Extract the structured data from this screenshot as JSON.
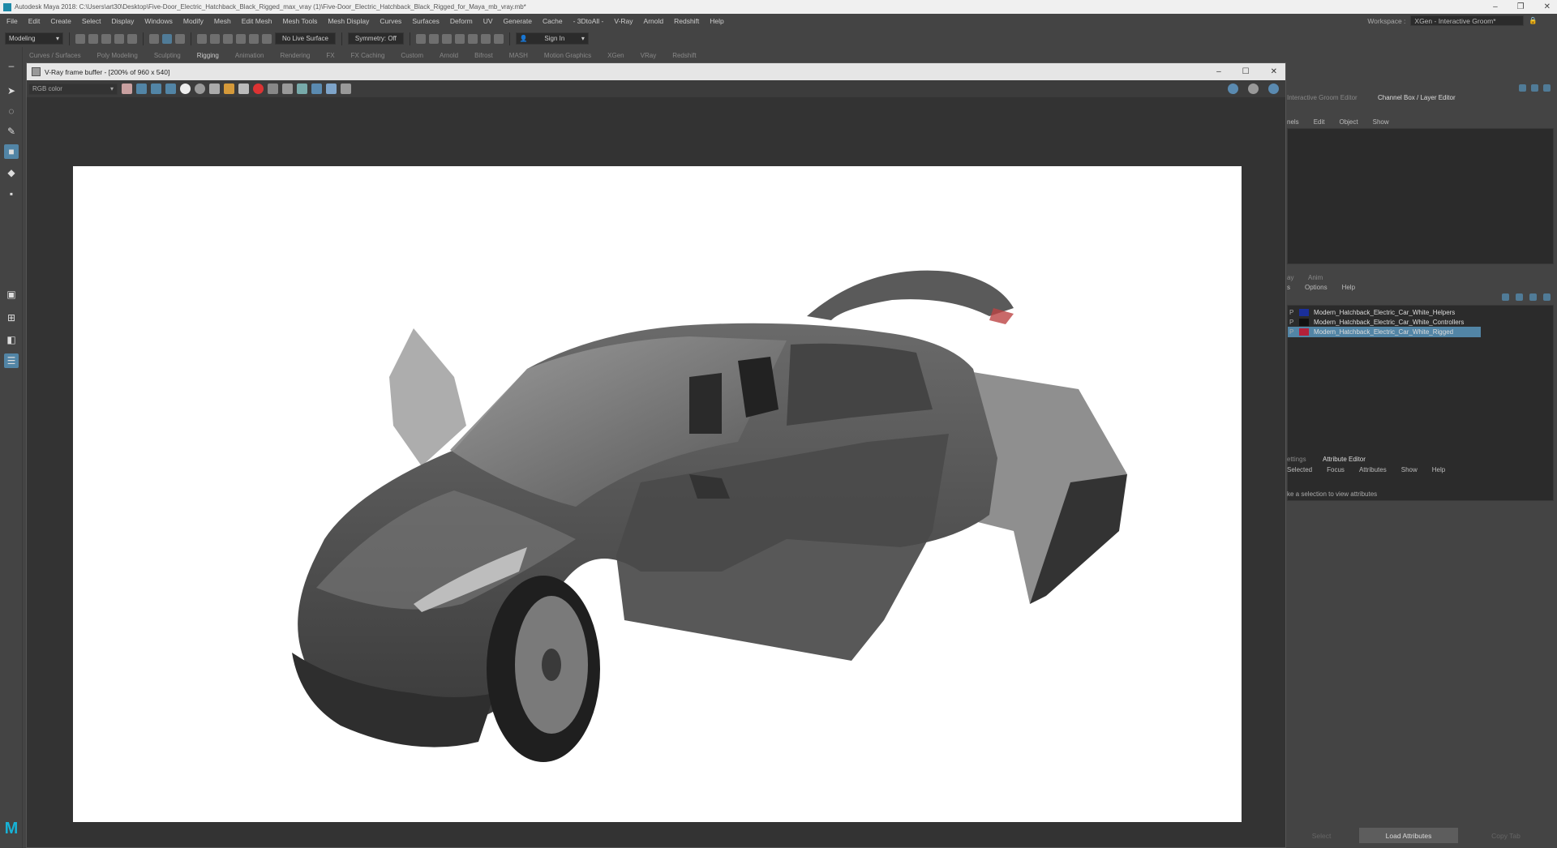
{
  "window": {
    "title": "Autodesk Maya 2018: C:\\Users\\art30\\Desktop\\Five-Door_Electric_Hatchback_Black_Rigged_max_vray (1)\\Five-Door_Electric_Hatchback_Black_Rigged_for_Maya_mb_vray.mb*"
  },
  "menus": [
    "File",
    "Edit",
    "Create",
    "Select",
    "Display",
    "Windows",
    "Modify",
    "Mesh",
    "Edit Mesh",
    "Mesh Tools",
    "Mesh Display",
    "Curves",
    "Surfaces",
    "Deform",
    "UV",
    "Generate",
    "Cache",
    "- 3DtoAll -",
    "V-Ray",
    "Arnold",
    "Redshift",
    "Help"
  ],
  "workspace": {
    "label": "Workspace :",
    "value": "XGen - Interactive Groom*"
  },
  "status": {
    "mode": "Modeling",
    "live_surface": "No Live Surface",
    "symmetry": "Symmetry: Off",
    "sign_in": "Sign In"
  },
  "shelf_tabs": [
    "Curves / Surfaces",
    "Poly Modeling",
    "Sculpting",
    "Rigging",
    "Animation",
    "Rendering",
    "FX",
    "FX Caching",
    "Custom",
    "Arnold",
    "Bifrost",
    "MASH",
    "Motion Graphics",
    "XGen",
    "VRay",
    "Redshift"
  ],
  "shelf_active": "Rigging",
  "vray": {
    "title": "V-Ray frame buffer - [200% of 960 x 540]",
    "channel": "RGB color"
  },
  "right_panel": {
    "tab_left": "Interactive Groom Editor",
    "tab_right": "Channel Box / Layer Editor",
    "cb_menu": [
      "nels",
      "Edit",
      "Object",
      "Show"
    ],
    "layer_tabs": [
      "ay",
      "Anim"
    ],
    "layer_menu": [
      "s",
      "Options",
      "Help"
    ],
    "layers": [
      {
        "v": "P",
        "color": "#1a2f9a",
        "name": "Modern_Hatchback_Electric_Car_White_Helpers",
        "selected": false
      },
      {
        "v": "P",
        "color": "#111111",
        "name": "Modern_Hatchback_Electric_Car_White_Controllers",
        "selected": false
      },
      {
        "v": "P",
        "color": "#b3213a",
        "name": "Modern_Hatchback_Electric_Car_White_Rigged",
        "selected": true
      }
    ],
    "attr_tab_left": "ettings",
    "attr_tab_right": "Attribute Editor",
    "attr_menu": [
      "Selected",
      "Focus",
      "Attributes",
      "Show",
      "Help"
    ],
    "attr_hint": "ke a selection to view attributes",
    "buttons": {
      "select": "Select",
      "load": "Load Attributes",
      "copy": "Copy Tab"
    }
  },
  "colors": {
    "accent": "#5285a6",
    "panel": "#444444",
    "dark": "#2b2b2b"
  }
}
